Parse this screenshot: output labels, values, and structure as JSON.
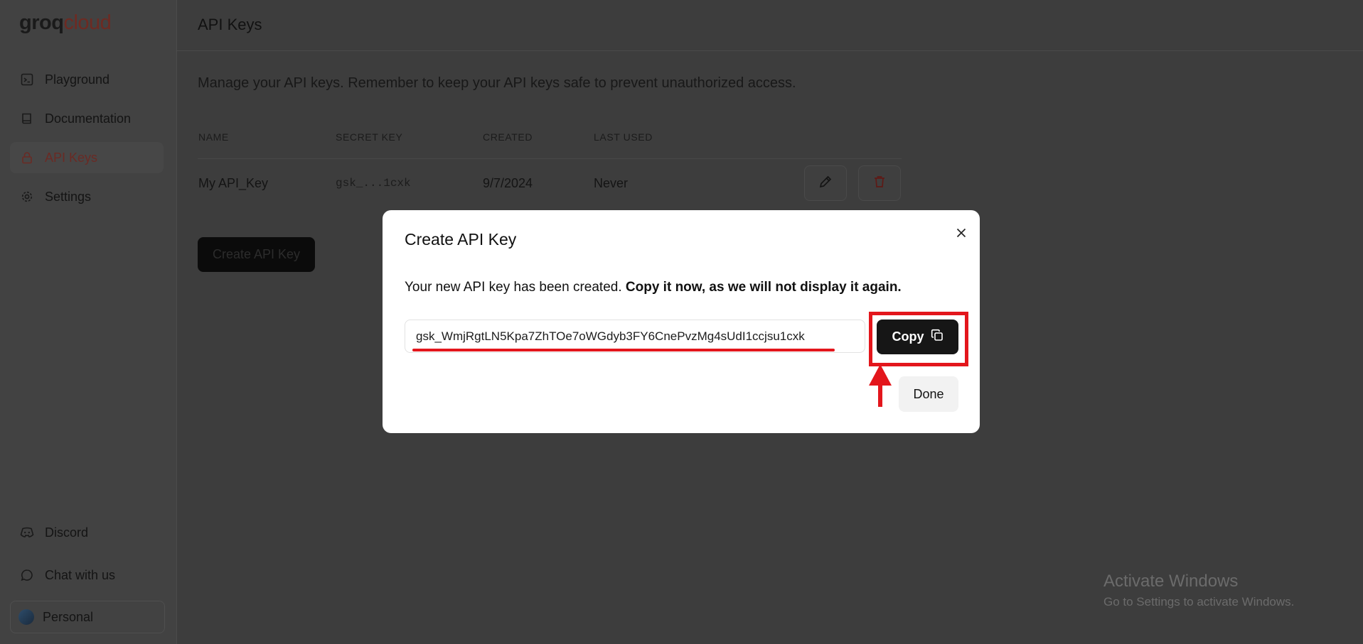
{
  "brand": {
    "logo_part1": "groq",
    "logo_part2": "cloud"
  },
  "sidebar": {
    "items": [
      {
        "label": "Playground",
        "icon": "terminal-icon"
      },
      {
        "label": "Documentation",
        "icon": "book-icon"
      },
      {
        "label": "API Keys",
        "icon": "lock-icon",
        "active": true
      },
      {
        "label": "Settings",
        "icon": "gear-icon"
      }
    ],
    "bottom": [
      {
        "label": "Discord",
        "icon": "discord-icon"
      },
      {
        "label": "Chat with us",
        "icon": "chat-bubble-icon"
      }
    ],
    "account": {
      "label": "Personal"
    }
  },
  "header": {
    "title": "API Keys"
  },
  "main": {
    "description": "Manage your API keys. Remember to keep your API keys safe to prevent unauthorized access.",
    "table": {
      "columns": [
        "NAME",
        "SECRET KEY",
        "CREATED",
        "LAST USED"
      ],
      "rows": [
        {
          "name": "My API_Key",
          "secret": "gsk_...1cxk",
          "created": "9/7/2024",
          "last_used": "Never"
        }
      ]
    },
    "create_button": "Create API Key"
  },
  "modal": {
    "title": "Create API Key",
    "message_plain": "Your new API key has been created.",
    "message_bold": "Copy it now, as we will not display it again.",
    "api_key": "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",
    "copy_label": "Copy",
    "done_label": "Done"
  },
  "watermark": {
    "title": "Activate Windows",
    "subtitle": "Go to Settings to activate Windows."
  },
  "colors": {
    "overlay_bg": "#3d3d3d",
    "annotation_red": "#e3161c",
    "active_nav": "#6a2a24",
    "primary_button": "#161616"
  }
}
